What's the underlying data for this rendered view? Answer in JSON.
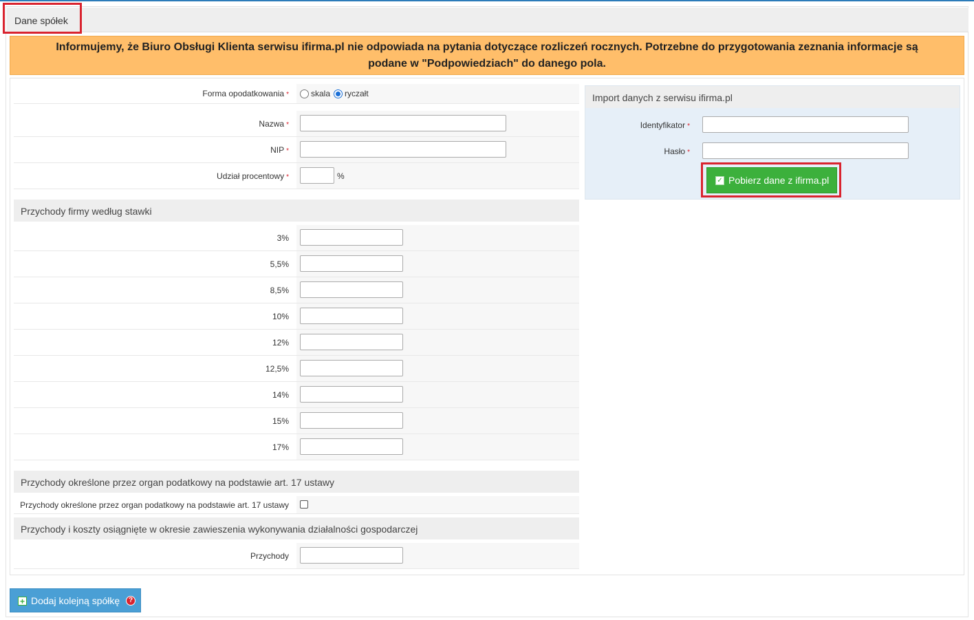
{
  "header": {
    "title": "Dane spółek"
  },
  "notice": {
    "line1": "Informujemy, że Biuro Obsługi Klienta serwisu ifirma.pl nie odpowiada na pytania dotyczące rozliczeń rocznych. Potrzebne do przygotowania zeznania informacje są",
    "line2": "podane w \"Podpowiedziach\" do danego pola."
  },
  "form": {
    "forma_label": "Forma opodatkowania",
    "forma_options": [
      "skala",
      "ryczałt"
    ],
    "forma_selected": "ryczałt",
    "nazwa_label": "Nazwa",
    "nip_label": "NIP",
    "udzial_label": "Udział procentowy",
    "udzial_unit": "%",
    "required_mark": "*"
  },
  "rates_section": {
    "title": "Przychody firmy według stawki",
    "rates": [
      "3%",
      "5,5%",
      "8,5%",
      "10%",
      "12%",
      "12,5%",
      "14%",
      "15%",
      "17%"
    ]
  },
  "art17_section": {
    "title": "Przychody określone przez organ podatkowy na podstawie art. 17 ustawy",
    "checkbox_label": "Przychody określone przez organ podatkowy na podstawie art. 17 ustawy"
  },
  "suspension_section": {
    "title": "Przychody i koszty osiągnięte w okresie zawieszenia wykonywania działalności gospodarczej",
    "przychody_label": "Przychody"
  },
  "import": {
    "title": "Import danych z serwisu ifirma.pl",
    "id_label": "Identyfikator",
    "password_label": "Hasło",
    "button_label": "Pobierz dane z ifirma.pl"
  },
  "footer": {
    "add_button_label": "Dodaj kolejną spółkę"
  },
  "colors": {
    "notice_bg": "#ffbe6a",
    "green_button": "#3cb03c",
    "blue_button": "#4a9fd5",
    "highlight": "#d9232e"
  }
}
